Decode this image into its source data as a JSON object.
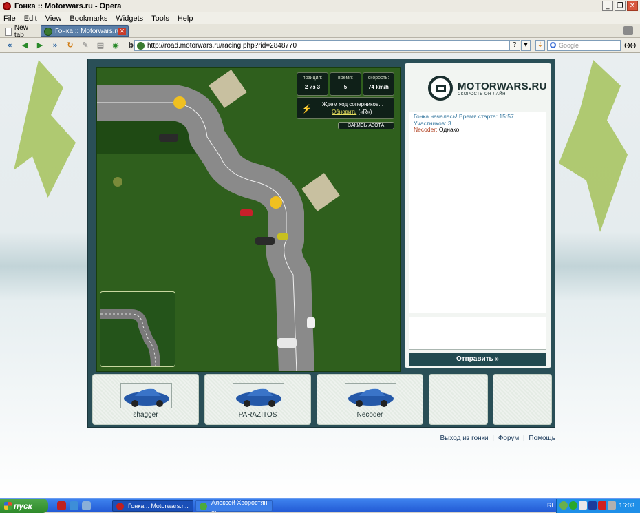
{
  "window": {
    "title": "Гонка :: Motorwars.ru - Opera",
    "buttons": [
      "_",
      "❐",
      "✕"
    ]
  },
  "menu": [
    "File",
    "Edit",
    "View",
    "Bookmarks",
    "Widgets",
    "Tools",
    "Help"
  ],
  "tabs": [
    {
      "label": "New tab"
    },
    {
      "label": "Гонка :: Motorwars.ru"
    }
  ],
  "address": {
    "url": "http://road.motorwars.ru/racing.php?rid=2848770",
    "help": "?",
    "dropdown": "▾"
  },
  "search": {
    "placeholder": "Google"
  },
  "hud": {
    "position_label": "позиция:",
    "position_value": "2 из 3",
    "time_label": "время:",
    "time_value": "5",
    "speed_label": "скорость:",
    "speed_value": "74 km/h",
    "wait_text": "Ждем ход соперников...",
    "refresh_link": "Обновить",
    "refresh_hint": "(«R»)",
    "nitro_button": "ЗАКИСЬ АЗОТА"
  },
  "logo": {
    "name": "MOTORWARS.RU",
    "tagline": "СКОРОСТЬ ОН-ЛАЙН"
  },
  "chat": {
    "system": "Гонка началась! Время старта: 15:57. Участников: 3",
    "nick": "Necoder:",
    "message": "Однако!",
    "send_button": "Отправить »"
  },
  "players": [
    {
      "name": "shagger"
    },
    {
      "name": "PARAZITOS"
    },
    {
      "name": "Necoder"
    }
  ],
  "footer_links": {
    "exit": "Выход из гонки",
    "forum": "Форум",
    "help": "Помощь",
    "sep": "|"
  },
  "taskbar": {
    "start": "пуск",
    "task1": "Гонка :: Motorwars.r...",
    "task2": "Алексей Хворостян ...",
    "lang": "RL",
    "time": "16:03"
  },
  "colors": {
    "frame": "#2a4f57",
    "grass": "#2f5f1d",
    "send": "#21494f",
    "taskbar": "#2259d4"
  }
}
